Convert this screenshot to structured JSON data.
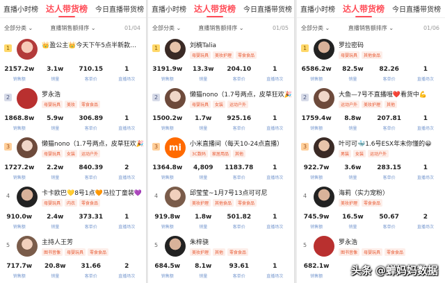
{
  "watermark": "头条 @蝉妈妈数据",
  "panels": [
    {
      "tabs": [
        "直播小时榜",
        "达人带货榜",
        "今日直播带货榜"
      ],
      "category": "全部分类 ⌄",
      "sort": "直播销售额排序 ⌄",
      "page": "01/04",
      "rows": [
        {
          "rank": "1",
          "name": "👑盈公主👑今天下午5点半新款…",
          "tags": [],
          "stats": [
            "2157.2w",
            "3.1w",
            "710.15",
            "1"
          ],
          "labels": [
            "销售额",
            "销量",
            "客单价",
            "直播场次"
          ]
        },
        {
          "rank": "2",
          "name": "罗永浩",
          "tags": [
            "母婴玩具",
            "美妆",
            "零食食品"
          ],
          "stats": [
            "1868.8w",
            "5.9w",
            "306.89",
            "1"
          ],
          "labels": [
            "销售额",
            "销量",
            "客单价",
            "直播场次"
          ]
        },
        {
          "rank": "3",
          "name": "懒猫nono（1.7号两点，皮草狂欢🎉",
          "tags": [
            "母婴玩具",
            "女装",
            "运动户外"
          ],
          "stats": [
            "1727.2w",
            "2.2w",
            "840.39",
            "2"
          ],
          "labels": [
            "销售额",
            "销量",
            "客单价",
            "直播场次"
          ]
        },
        {
          "rank": "4",
          "name": "卡卡欧巴💛8号1点🧡马拉丁童装💜",
          "tags": [
            "母婴玩具",
            "内衣",
            "零食食品"
          ],
          "stats": [
            "910.0w",
            "2.4w",
            "373.31",
            "1"
          ],
          "labels": [
            "销售额",
            "销量",
            "客单价",
            "直播场次"
          ]
        },
        {
          "rank": "5",
          "name": "主持人王芳",
          "tags": [
            "图书音像",
            "母婴玩具",
            "零食食品"
          ],
          "stats": [
            "717.7w",
            "20.8w",
            "31.66",
            "2"
          ],
          "labels": [
            "销售额",
            "销量",
            "客单价",
            "直播场次"
          ]
        }
      ]
    },
    {
      "tabs": [
        "直播小时榜",
        "达人带货榜",
        "今日直播带货榜"
      ],
      "category": "全部分类 ⌄",
      "sort": "直播销售额排序 ⌄",
      "page": "01/05",
      "rows": [
        {
          "rank": "1",
          "name": "刘楠Talia",
          "tags": [
            "母婴玩具",
            "美妆护理",
            "零食食品"
          ],
          "stats": [
            "3191.9w",
            "13.3w",
            "204.10",
            "1"
          ],
          "labels": [
            "销售额",
            "销量",
            "客单价",
            "直播场次"
          ]
        },
        {
          "rank": "2",
          "name": "懒猫nono（1.7号两点，皮草狂欢🎉",
          "tags": [
            "母婴玩具",
            "女装",
            "运动户外"
          ],
          "stats": [
            "1500.2w",
            "1.7w",
            "925.16",
            "1"
          ],
          "labels": [
            "销售额",
            "销量",
            "客单价",
            "直播场次"
          ]
        },
        {
          "rank": "3",
          "name": "小米直播间（每天10-24点直播）",
          "tags": [
            "3C数码",
            "家居用品",
            "其他"
          ],
          "stats": [
            "1364.8w",
            "4,809",
            "1183.78",
            "1"
          ],
          "labels": [
            "销售额",
            "销量",
            "客单价",
            "直播场次"
          ]
        },
        {
          "rank": "4",
          "name": "邱莹莹~1月7号13点可可尼",
          "tags": [
            "美妆护理",
            "其他食品",
            "零食食品"
          ],
          "stats": [
            "919.8w",
            "1.8w",
            "501.82",
            "1"
          ],
          "labels": [
            "销售额",
            "销量",
            "客单价",
            "直播场次"
          ]
        },
        {
          "rank": "5",
          "name": "朱梓骁",
          "tags": [
            "美妆护理",
            "其他",
            "零食食品"
          ],
          "stats": [
            "684.5w",
            "8.1w",
            "93.61",
            "1"
          ],
          "labels": [
            "销售额",
            "销量",
            "客单价",
            "直播场次"
          ]
        }
      ]
    },
    {
      "tabs": [
        "直播小时榜",
        "达人带货榜",
        "今日直播带货榜"
      ],
      "category": "全部分类 ⌄",
      "sort": "直播销售额排序 ⌄",
      "page": "01/06",
      "rows": [
        {
          "rank": "1",
          "name": "罗拉密码",
          "tags": [
            "母婴玩具",
            "其他食品"
          ],
          "stats": [
            "6586.2w",
            "82.5w",
            "82.26",
            "1"
          ],
          "labels": [
            "销售额",
            "销量",
            "客单价",
            "直播场次"
          ]
        },
        {
          "rank": "2",
          "name": "大鱼—7号不直播哦❤️看货中💪",
          "tags": [
            "运动户外",
            "美妆护理",
            "其他"
          ],
          "stats": [
            "1759.4w",
            "8.8w",
            "207.81",
            "1"
          ],
          "labels": [
            "销售额",
            "销量",
            "客单价",
            "直播场次"
          ]
        },
        {
          "rank": "3",
          "name": "叶可可🐳1.6号ESX年末你懂的😀",
          "tags": [
            "男装",
            "女装",
            "运动户外"
          ],
          "stats": [
            "922.7w",
            "3.6w",
            "283.15",
            "1"
          ],
          "labels": [
            "销售额",
            "销量",
            "客单价",
            "直播场次"
          ]
        },
        {
          "rank": "4",
          "name": "海莉（实力宠粉）",
          "tags": [
            "美妆护理",
            "零食食品"
          ],
          "stats": [
            "745.9w",
            "16.5w",
            "50.67",
            "2"
          ],
          "labels": [
            "销售额",
            "销量",
            "客单价",
            "直播场次"
          ]
        },
        {
          "rank": "5",
          "name": "罗永浩",
          "tags": [
            "图书音像",
            "母婴玩具",
            "零食食品"
          ],
          "stats": [
            "682.1w",
            "",
            "",
            ""
          ],
          "labels": [
            "销售额",
            "",
            "",
            ""
          ]
        }
      ]
    }
  ]
}
